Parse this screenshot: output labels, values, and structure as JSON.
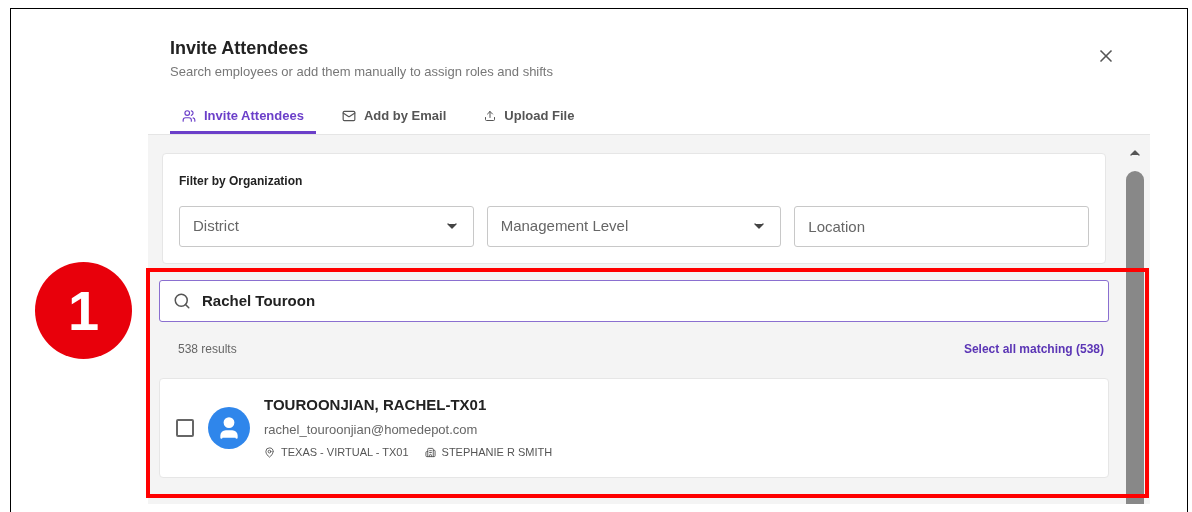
{
  "dialog": {
    "title": "Invite Attendees",
    "subtitle": "Search employees or add them manually to assign roles and shifts"
  },
  "tabs": [
    {
      "label": "Invite Attendees",
      "kind": "people",
      "selected": true
    },
    {
      "label": "Add by Email",
      "kind": "mail",
      "selected": false
    },
    {
      "label": "Upload File",
      "kind": "upload",
      "selected": false
    }
  ],
  "filter": {
    "label": "Filter by Organization",
    "fields": [
      {
        "placeholder": "District",
        "kind": "dropdown"
      },
      {
        "placeholder": "Management Level",
        "kind": "dropdown"
      },
      {
        "placeholder": "Location",
        "kind": "text"
      }
    ]
  },
  "search": {
    "value": "Rachel Touroon"
  },
  "results_count": "538 results",
  "select_all": "Select all matching (538)",
  "results": [
    {
      "name": "TOUROONJIAN, RACHEL-TX01",
      "email": "rachel_touroonjian@homedepot.com",
      "location": "TEXAS - VIRTUAL - TX01",
      "manager": "STEPHANIE R SMITH",
      "checked": false
    }
  ],
  "annotation": {
    "number": "1"
  }
}
